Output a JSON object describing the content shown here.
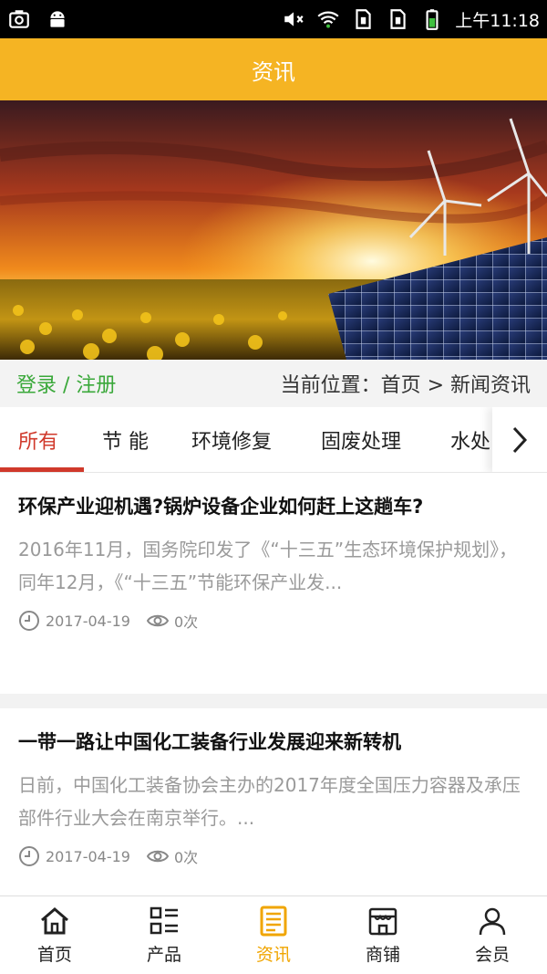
{
  "status_bar": {
    "time": "上午11:18",
    "icons": [
      "screenshot-icon",
      "android-icon",
      "mute-icon",
      "wifi-icon",
      "sim1-icon",
      "sim2-icon",
      "battery-icon"
    ]
  },
  "header": {
    "title": "资讯"
  },
  "breadcrumb": {
    "login": "登录 / 注册",
    "location": "当前位置：首页 > 新闻资讯"
  },
  "tabs": [
    {
      "label": "所有",
      "active": true
    },
    {
      "label": "节 能"
    },
    {
      "label": "环境修复"
    },
    {
      "label": "固废处理"
    },
    {
      "label": "水处"
    }
  ],
  "articles": [
    {
      "title": "环保产业迎机遇?锅炉设备企业如何赶上这趟车?",
      "summary": "2016年11月，国务院印发了《“十三五”生态环境保护规划》，同年12月，《“十三五”节能环保产业发...",
      "date": "2017-04-19",
      "views": "0次"
    },
    {
      "title": "一带一路让中国化工装备行业发展迎来新转机",
      "summary": "日前，中国化工装备协会主办的2017年度全国压力容器及承压部件行业大会在南京举行。...",
      "date": "2017-04-19",
      "views": "0次"
    }
  ],
  "bottom_nav": [
    {
      "label": "首页",
      "icon": "home-icon"
    },
    {
      "label": "产品",
      "icon": "list-icon"
    },
    {
      "label": "资讯",
      "icon": "news-icon",
      "active": true
    },
    {
      "label": "商铺",
      "icon": "shop-icon"
    },
    {
      "label": "会员",
      "icon": "user-icon"
    }
  ],
  "colors": {
    "header": "#f5b423",
    "active_tab": "#d0392b",
    "login": "#3aa83a",
    "nav_active": "#f0a500"
  }
}
